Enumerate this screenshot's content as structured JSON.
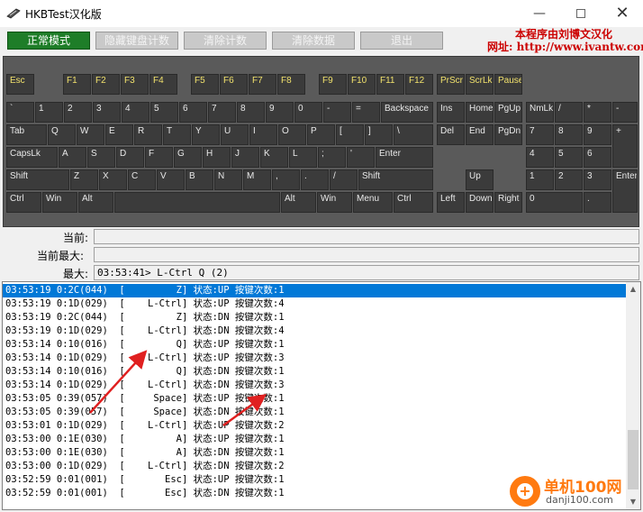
{
  "window": {
    "title": "HKBTest汉化版",
    "minimize": "—",
    "close": "✕"
  },
  "watermark": {
    "line1": "本程序由刘博文汉化",
    "line2": "网址: http://www.ivantw.com",
    "logo_text": "单机100网",
    "logo_url": "danji100.com"
  },
  "modes": [
    {
      "label": "正常模式",
      "active": true
    },
    {
      "label": "隐藏键盘计数",
      "active": false
    },
    {
      "label": "清除计数",
      "active": false
    },
    {
      "label": "清除数据",
      "active": false
    },
    {
      "label": "退出",
      "active": false
    }
  ],
  "keys": {
    "esc": "Esc",
    "f1": "F1",
    "f2": "F2",
    "f3": "F3",
    "f4": "F4",
    "f5": "F5",
    "f6": "F6",
    "f7": "F7",
    "f8": "F8",
    "f9": "F9",
    "f10": "F10",
    "f11": "F11",
    "f12": "F12",
    "prscr": "PrScr",
    "scrlk": "ScrLk",
    "pause": "Pause",
    "backtick": "`",
    "d1": "1",
    "d2": "2",
    "d3": "3",
    "d4": "4",
    "d5": "5",
    "d6": "6",
    "d7": "7",
    "d8": "8",
    "d9": "9",
    "d0": "0",
    "minus": "-",
    "equals": "=",
    "backspace": "Backspace",
    "ins": "Ins",
    "home": "Home",
    "pgup": "PgUp",
    "numlk": "NmLk",
    "num_div": "/",
    "num_mul": "*",
    "num_sub": "-",
    "tab": "Tab",
    "q": "Q",
    "w": "W",
    "e": "E",
    "r": "R",
    "t": "T",
    "y": "Y",
    "u": "U",
    "i": "I",
    "o": "O",
    "p": "P",
    "lbracket": "[",
    "rbracket": "]",
    "backslash": "\\",
    "del": "Del",
    "end": "End",
    "pgdn": "PgDn",
    "num7": "7",
    "num8": "8",
    "num9": "9",
    "num_add": "+",
    "capslk": "CapsLk",
    "a": "A",
    "s": "S",
    "d": "D",
    "f": "F",
    "g": "G",
    "h": "H",
    "j": "J",
    "k": "K",
    "l": "L",
    "semicolon": ";",
    "quote": "'",
    "enter": "Enter",
    "num4": "4",
    "num5": "5",
    "num6": "6",
    "lshift": "Shift",
    "z": "Z",
    "x": "X",
    "c": "C",
    "v": "V",
    "b": "B",
    "n": "N",
    "m": "M",
    "comma": ",",
    "period": ".",
    "slash": "/",
    "rshift": "Shift",
    "up": "Up",
    "num1": "1",
    "num2": "2",
    "num3": "3",
    "num_enter": "Enter",
    "lctrl": "Ctrl",
    "lwin": "Win",
    "lalt": "Alt",
    "ralt": "Alt",
    "rwin": "Win",
    "menu": "Menu",
    "rctrl": "Ctrl",
    "left": "Left",
    "down": "Down",
    "right": "Right",
    "num0": "0",
    "num_dot": "."
  },
  "status": {
    "current_label": "当前:",
    "current_value": "",
    "current_max_label": "当前最大:",
    "current_max_value": "",
    "max_label": "最大:",
    "max_value": "03:53:41> L-Ctrl Q (2)"
  },
  "log": [
    "03:53:19 0:2C(044)  [         Z] 状态:UP 按键次数:1",
    "03:53:19 0:1D(029)  [    L-Ctrl] 状态:UP 按键次数:4",
    "03:53:19 0:2C(044)  [         Z] 状态:DN 按键次数:1",
    "03:53:19 0:1D(029)  [    L-Ctrl] 状态:DN 按键次数:4",
    "03:53:14 0:10(016)  [         Q] 状态:UP 按键次数:1",
    "03:53:14 0:1D(029)  [    L-Ctrl] 状态:UP 按键次数:3",
    "03:53:14 0:10(016)  [         Q] 状态:DN 按键次数:1",
    "03:53:14 0:1D(029)  [    L-Ctrl] 状态:DN 按键次数:3",
    "03:53:05 0:39(057)  [     Space] 状态:UP 按键次数:1",
    "03:53:05 0:39(057)  [     Space] 状态:DN 按键次数:1",
    "03:53:01 0:1D(029)  [    L-Ctrl] 状态:UP 按键次数:2",
    "03:53:00 0:1E(030)  [         A] 状态:UP 按键次数:1",
    "03:53:00 0:1E(030)  [         A] 状态:DN 按键次数:1",
    "03:53:00 0:1D(029)  [    L-Ctrl] 状态:DN 按键次数:2",
    "03:52:59 0:01(001)  [       Esc] 状态:UP 按键次数:1",
    "03:52:59 0:01(001)  [       Esc] 状态:DN 按键次数:1"
  ],
  "selected_row_index": 0,
  "colors": {
    "active_mode": "#1e7d28",
    "fn_key_text": "#f1e16c",
    "selection": "#0078d7",
    "annotation_arrow": "#e02020",
    "watermark_red": "#cc0000",
    "logo_orange": "#ff7a10"
  },
  "icons": {
    "app": "keyboard-icon",
    "scroll_up": "▲",
    "scroll_down": "▼",
    "logo_plus": "+"
  }
}
